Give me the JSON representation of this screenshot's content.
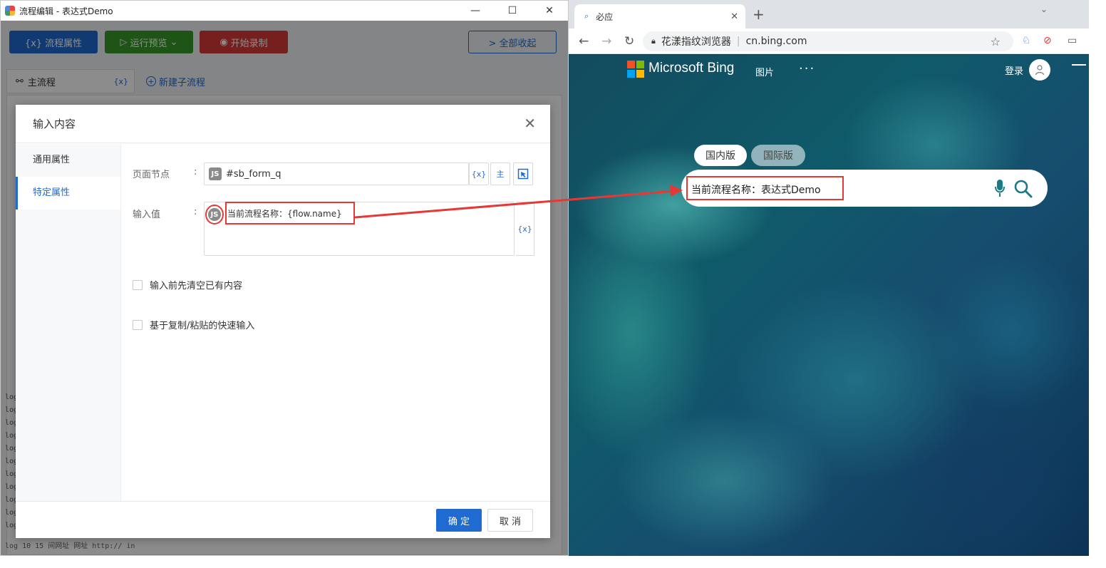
{
  "editor": {
    "title": "流程编辑 - 表达式Demo",
    "window_buttons": [
      "—",
      "☐",
      "✕"
    ],
    "toolbar": {
      "flow_props": "{x} 流程属性",
      "run_preview": "运行预览",
      "start_record": "开始录制",
      "collapse_all": "> 全部收起"
    },
    "tabs": {
      "main_flow": "主流程",
      "main_flow_var": "{x}",
      "new_subflow": "新建子流程"
    },
    "log_lines": [
      "log",
      "log",
      "log",
      "log",
      "log",
      "log",
      "log",
      "log",
      "log",
      "log",
      "log",
      "log"
    ],
    "bottom_log": "log 10   15  间网址    网址  http://    in"
  },
  "dialog": {
    "title": "输入内容",
    "sidebar": [
      "通用属性",
      "特定属性"
    ],
    "active_side": 1,
    "page_node_label": "页面节点",
    "page_node_value": "#sb_form_q",
    "js_badge": "JS",
    "var_btn": "{x}",
    "tree_btn": "主",
    "input_value_label": "输入值",
    "input_value": "当前流程名称：{flow.name}",
    "colon": ":",
    "checkbox_clear": "输入前先清空已有内容",
    "checkbox_paste": "基于复制/粘贴的快速输入",
    "ok": "确 定",
    "cancel": "取 消"
  },
  "browser": {
    "tab_title": "必应",
    "address_label": "花漾指纹浏览器",
    "address_url": "cn.bing.com",
    "brand": "Microsoft Bing",
    "nav_images": "图片",
    "nav_more": "···",
    "login": "登录",
    "region_domestic": "国内版",
    "region_intl": "国际版",
    "search_value": "当前流程名称：表达式Demo",
    "colors": {
      "ms_red": "#f25022",
      "ms_green": "#7fba00",
      "ms_blue": "#00a4ef",
      "ms_yellow": "#ffb900",
      "annotation": "#e53935",
      "accent": "#1f6bd1"
    }
  }
}
